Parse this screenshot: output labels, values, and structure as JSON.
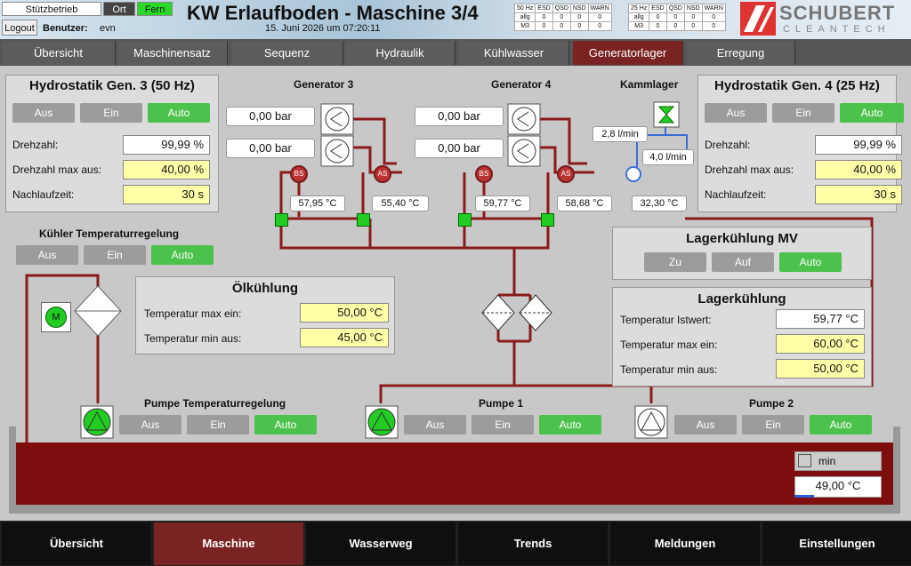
{
  "header": {
    "mode_label": "Stützbetrieb",
    "ort_label": "Ort",
    "fern_label": "Fern",
    "logout_label": "Logout",
    "user_label": "Benutzer:",
    "user_value": "evn",
    "title": "KW Erlaufboden - Maschine 3/4",
    "datetime": "15. Juni 2026 um 07:20:11",
    "logo_line1": "SCHUBERT",
    "logo_line2": "CLEANTECH"
  },
  "status_left": {
    "headers": [
      "50 Hz",
      "ESD",
      "QSD",
      "NSD",
      "WARN"
    ],
    "rows": [
      [
        "allg",
        "0",
        "0",
        "0",
        "0"
      ],
      [
        "M3",
        "0",
        "0",
        "0",
        "0"
      ]
    ]
  },
  "status_right": {
    "headers": [
      "25 Hz",
      "ESD",
      "QSD",
      "NSD",
      "WARN"
    ],
    "rows": [
      [
        "allg",
        "0",
        "0",
        "0",
        "0"
      ],
      [
        "M3",
        "0",
        "0",
        "0",
        "0"
      ]
    ]
  },
  "tabs": [
    "Übersicht",
    "Maschinensatz",
    "Sequenz",
    "Hydraulik",
    "Kühlwasser",
    "Generatorlager",
    "Erregung"
  ],
  "hs3": {
    "title": "Hydrostatik Gen. 3 (50 Hz)",
    "buttons": [
      "Aus",
      "Ein",
      "Auto"
    ],
    "rows": [
      {
        "label": "Drehzahl:",
        "value": "99,99 %"
      },
      {
        "label": "Drehzahl max aus:",
        "value": "40,00 %"
      },
      {
        "label": "Nachlaufzeit:",
        "value": "30 s"
      }
    ]
  },
  "hs4": {
    "title": "Hydrostatik Gen. 4 (25 Hz)",
    "buttons": [
      "Aus",
      "Ein",
      "Auto"
    ],
    "rows": [
      {
        "label": "Drehzahl:",
        "value": "99,99 %"
      },
      {
        "label": "Drehzahl max aus:",
        "value": "40,00 %"
      },
      {
        "label": "Nachlaufzeit:",
        "value": "30 s"
      }
    ]
  },
  "gen3": {
    "title": "Generator 3",
    "p1": "0,00 bar",
    "p2": "0,00 bar",
    "t1": "57,95 °C",
    "t2": "55,40 °C",
    "bs": "BS",
    "as": "AS"
  },
  "gen4": {
    "title": "Generator 4",
    "p1": "0,00 bar",
    "p2": "0,00 bar",
    "t1": "59,77 °C",
    "t2": "58,68 °C",
    "bs": "BS",
    "as": "AS"
  },
  "kammlager": {
    "title": "Kammlager",
    "f1": "2,8 l/min",
    "f2": "4,0 l/min",
    "t": "32,30 °C"
  },
  "kuehler": {
    "title": "Kühler Temperaturregelung",
    "buttons": [
      "Aus",
      "Ein",
      "Auto"
    ],
    "motor": "M"
  },
  "oel": {
    "title": "Ölkühlung",
    "rows": [
      {
        "label": "Temperatur max ein:",
        "value": "50,00 °C"
      },
      {
        "label": "Temperatur min aus:",
        "value": "45,00 °C"
      }
    ]
  },
  "lkmv": {
    "title": "Lagerkühlung MV",
    "buttons": [
      "Zu",
      "Auf",
      "Auto"
    ]
  },
  "lk": {
    "title": "Lagerkühlung",
    "rows": [
      {
        "label": "Temperatur Istwert:",
        "value": "59,77 °C"
      },
      {
        "label": "Temperatur max ein:",
        "value": "60,00 °C"
      },
      {
        "label": "Temperatur min aus:",
        "value": "50,00 °C"
      }
    ]
  },
  "pumps": {
    "ptr_title": "Pumpe Temperaturregelung",
    "p1_title": "Pumpe 1",
    "p2_title": "Pumpe 2",
    "buttons": [
      "Aus",
      "Ein",
      "Auto"
    ]
  },
  "tank": {
    "min_label": "min",
    "temp": "49,00 °C",
    "level_fraction": 0.22
  },
  "footer": [
    "Übersicht",
    "Maschine",
    "Wasserweg",
    "Trends",
    "Meldungen",
    "Einstellungen"
  ],
  "colors": {
    "pipe": "#8b1a1a",
    "green": "#4cc24c",
    "tank": "#7e0e0e",
    "active_tab": "#7a2323"
  }
}
